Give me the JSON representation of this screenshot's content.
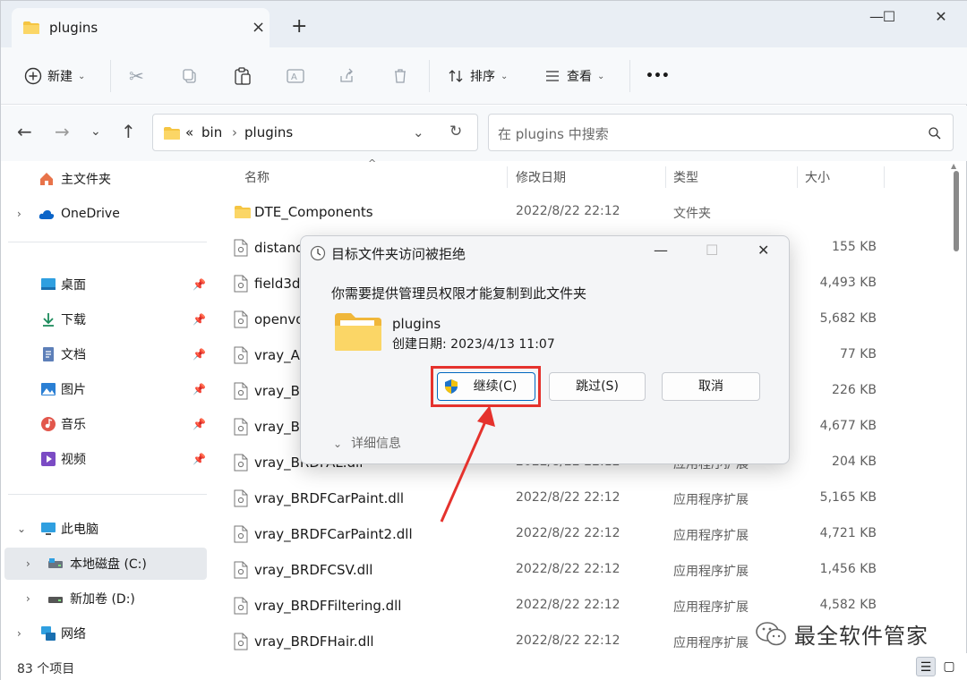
{
  "tab": {
    "title": "plugins",
    "close": "×",
    "new": "+"
  },
  "window_controls": {
    "minimize": "—",
    "maximize": "☐",
    "close": "✕"
  },
  "toolbar": {
    "new_label": "新建",
    "sort_label": "排序",
    "view_label": "查看",
    "more": "•••"
  },
  "address": {
    "overflow": "«",
    "crumbs": [
      "bin",
      "plugins"
    ]
  },
  "search": {
    "placeholder": "在 plugins 中搜索"
  },
  "sidebar": {
    "home": "主文件夹",
    "onedrive": "OneDrive",
    "quick": [
      "桌面",
      "下载",
      "文档",
      "图片",
      "音乐",
      "视频"
    ],
    "pc": "此电脑",
    "drive_c": "本地磁盘 (C:)",
    "drive_d": "新加卷 (D:)",
    "network": "网络"
  },
  "columns": {
    "name": "名称",
    "date": "修改日期",
    "type": "类型",
    "size": "大小"
  },
  "files": [
    {
      "name": "DTE_Components",
      "date": "2022/8/22 22:12",
      "type": "文件夹",
      "size": ""
    },
    {
      "name": "distanc",
      "date": "",
      "type": "",
      "size": "155 KB"
    },
    {
      "name": "field3dl",
      "date": "",
      "type": "",
      "size": "4,493 KB"
    },
    {
      "name": "openvo",
      "date": "",
      "type": "",
      "size": "5,682 KB"
    },
    {
      "name": "vray_AA",
      "date": "",
      "type": "",
      "size": "77 KB"
    },
    {
      "name": "vray_Ba",
      "date": "",
      "type": "",
      "size": "226 KB"
    },
    {
      "name": "vray_Bit",
      "date": "",
      "type": "",
      "size": "4,677 KB"
    },
    {
      "name": "vray_BRDFAL.dll",
      "date": "2022/8/22 22:12",
      "type": "应用程序扩展",
      "size": "204 KB"
    },
    {
      "name": "vray_BRDFCarPaint.dll",
      "date": "2022/8/22 22:12",
      "type": "应用程序扩展",
      "size": "5,165 KB"
    },
    {
      "name": "vray_BRDFCarPaint2.dll",
      "date": "2022/8/22 22:12",
      "type": "应用程序扩展",
      "size": "4,721 KB"
    },
    {
      "name": "vray_BRDFCSV.dll",
      "date": "2022/8/22 22:12",
      "type": "应用程序扩展",
      "size": "1,456 KB"
    },
    {
      "name": "vray_BRDFFiltering.dll",
      "date": "2022/8/22 22:12",
      "type": "应用程序扩展",
      "size": "4,582 KB"
    },
    {
      "name": "vray_BRDFHair.dll",
      "date": "2022/8/22 22:12",
      "type": "应用程序扩展",
      "size": ""
    }
  ],
  "status": {
    "count": "83 个项目"
  },
  "dialog": {
    "title": "目标文件夹访问被拒绝",
    "message": "你需要提供管理员权限才能复制到此文件夹",
    "folder_name": "plugins",
    "created": "创建日期: 2023/4/13 11:07",
    "continue_label": "继续(C)",
    "skip_label": "跳过(S)",
    "cancel_label": "取消",
    "details_label": "详细信息"
  },
  "watermark": {
    "text": "最全软件管家"
  },
  "colors": {
    "accent": "#0067c0",
    "highlight": "#e5322d",
    "folder": "#f5c542"
  }
}
